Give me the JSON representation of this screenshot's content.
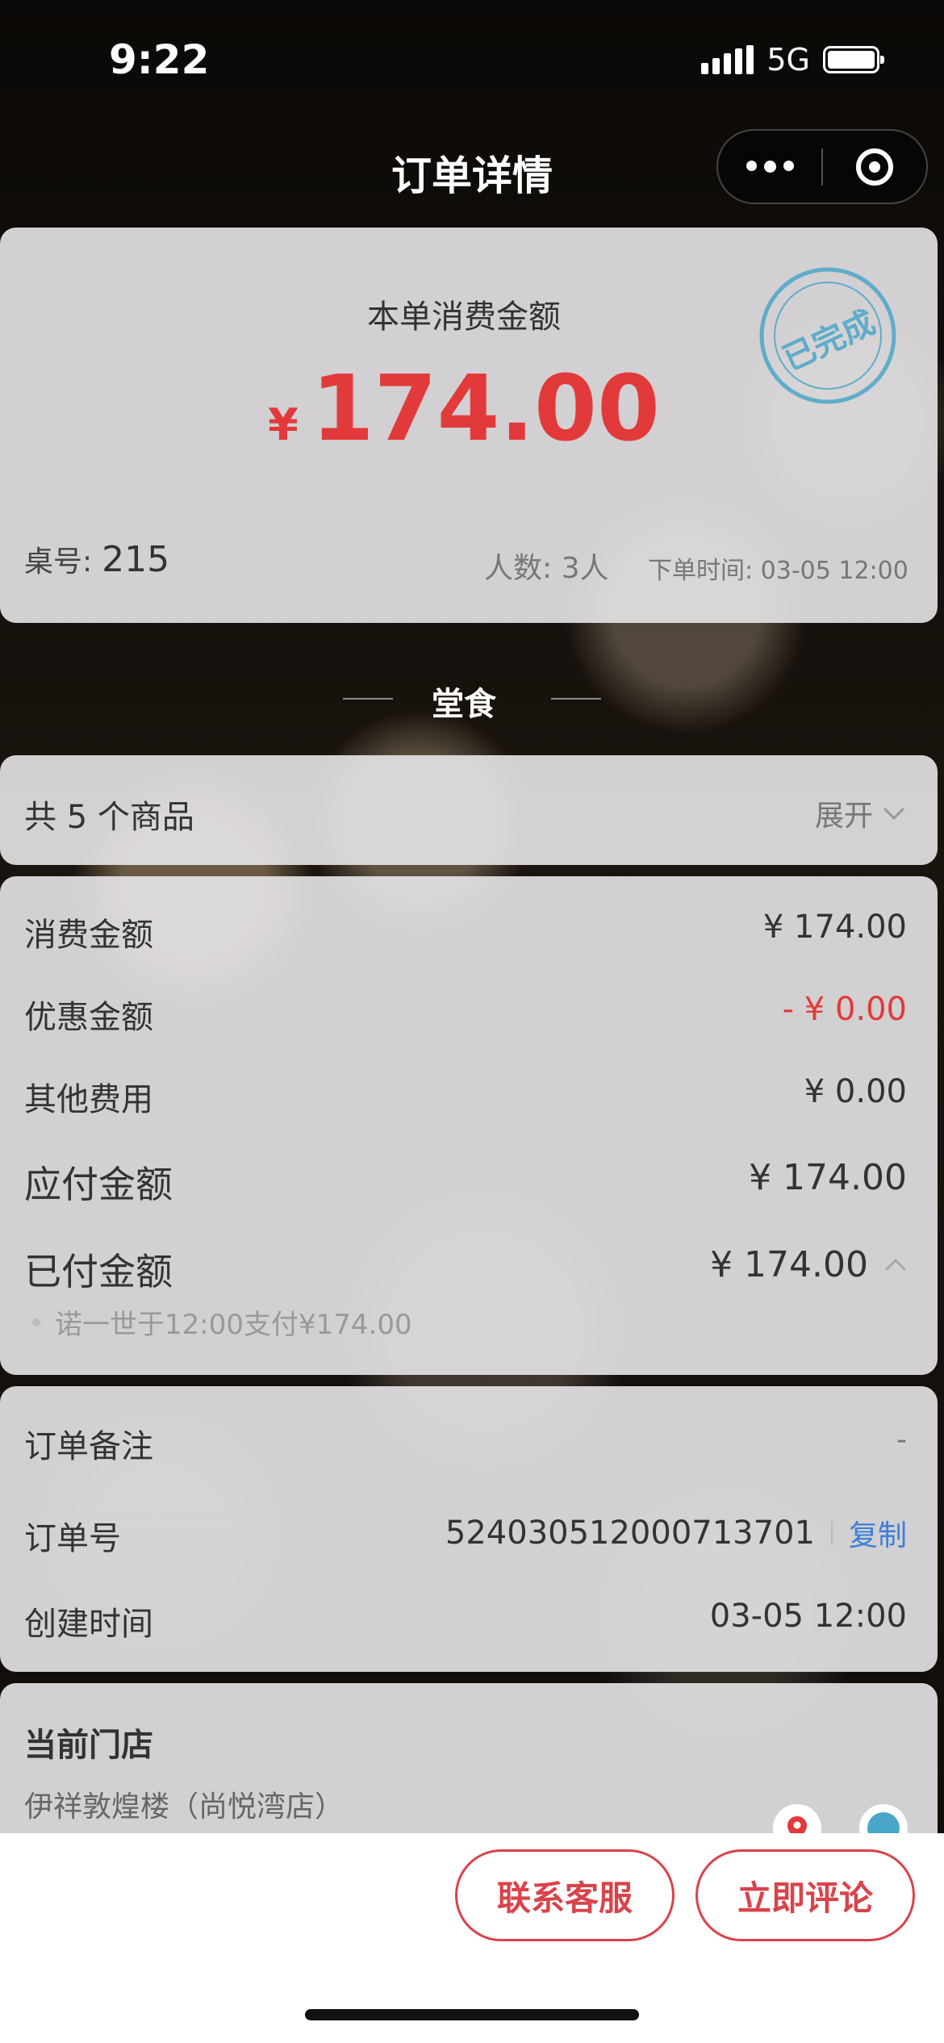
{
  "status_bar": {
    "time": "9:22",
    "network": "5G"
  },
  "nav": {
    "title": "订单详情"
  },
  "summary": {
    "amount_label": "本单消费金额",
    "currency": "¥",
    "amount": "174.00",
    "stamp": "已完成",
    "table_label": "桌号:",
    "table_no": "215",
    "people": "人数: 3人",
    "order_time": "下单时间: 03-05 12:00"
  },
  "section": {
    "title": "堂食"
  },
  "items": {
    "count_text": "共 5 个商品",
    "expand_label": "展开"
  },
  "fees": {
    "rows": [
      {
        "label": "消费金额",
        "value": "¥ 174.00"
      },
      {
        "label": "优惠金额",
        "value": "- ¥ 0.00"
      },
      {
        "label": "其他费用",
        "value": "¥ 0.00"
      },
      {
        "label": "应付金额",
        "value": "¥ 174.00"
      },
      {
        "label": "已付金额",
        "value": "¥ 174.00"
      }
    ],
    "payment_detail": "诺一世于12:00支付¥174.00"
  },
  "order_info": {
    "remark_label": "订单备注",
    "remark_value": "-",
    "order_no_label": "订单号",
    "order_no": "524030512000713701",
    "copy_label": "复制",
    "created_label": "创建时间",
    "created_value": "03-05 12:00"
  },
  "store": {
    "title": "当前门店",
    "name": "伊祥敦煌楼（尚悦湾店）"
  },
  "actions": {
    "contact": "联系客服",
    "review": "立即评论"
  },
  "colors": {
    "accent_red": "#e23a3a",
    "link_blue": "#3b7fd9",
    "stamp_blue": "#4aa6c9"
  }
}
